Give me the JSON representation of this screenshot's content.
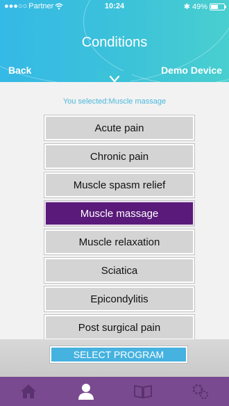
{
  "status_bar": {
    "carrier": "Partner",
    "time": "10:24",
    "battery": "49%"
  },
  "header": {
    "title": "Conditions",
    "back_label": "Back",
    "device_label": "Demo Device"
  },
  "selection": {
    "text": "You selected:Muscle massage"
  },
  "conditions": [
    {
      "label": "Acute pain",
      "selected": false
    },
    {
      "label": "Chronic pain",
      "selected": false
    },
    {
      "label": "Muscle spasm relief",
      "selected": false
    },
    {
      "label": "Muscle massage",
      "selected": true
    },
    {
      "label": "Muscle relaxation",
      "selected": false
    },
    {
      "label": "Sciatica",
      "selected": false
    },
    {
      "label": "Epicondylitis",
      "selected": false
    },
    {
      "label": "Post surgical pain",
      "selected": false
    }
  ],
  "footer": {
    "select_program_label": "SELECT PROGRAM"
  },
  "tab_bar": {
    "tabs": [
      {
        "icon": "home-icon",
        "active": false
      },
      {
        "icon": "user-icon",
        "active": true
      },
      {
        "icon": "book-icon",
        "active": false
      },
      {
        "icon": "settings-icon",
        "active": false
      }
    ]
  },
  "colors": {
    "header_accent": "#3cc2d9",
    "selected_item": "#5a1a7a",
    "button_blue": "#45b2e0",
    "tab_bar": "#7a4a90"
  }
}
